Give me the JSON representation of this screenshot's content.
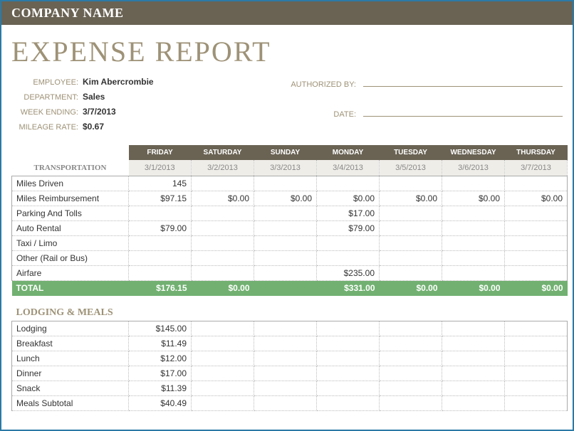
{
  "header": {
    "company": "COMPANY NAME",
    "title": "EXPENSE REPORT"
  },
  "meta": {
    "employee_label": "EMPLOYEE:",
    "employee": "Kim Abercrombie",
    "department_label": "DEPARTMENT:",
    "department": "Sales",
    "week_ending_label": "WEEK ENDING:",
    "week_ending": "3/7/2013",
    "mileage_rate_label": "MILEAGE RATE:",
    "mileage_rate": "$0.67",
    "authorized_by_label": "AUTHORIZED BY:",
    "date_label": "DATE:"
  },
  "days": [
    {
      "name": "FRIDAY",
      "date": "3/1/2013"
    },
    {
      "name": "SATURDAY",
      "date": "3/2/2013"
    },
    {
      "name": "SUNDAY",
      "date": "3/3/2013"
    },
    {
      "name": "MONDAY",
      "date": "3/4/2013"
    },
    {
      "name": "TUESDAY",
      "date": "3/5/2013"
    },
    {
      "name": "WEDNESDAY",
      "date": "3/6/2013"
    },
    {
      "name": "THURSDAY",
      "date": "3/7/2013"
    }
  ],
  "sections": {
    "transportation": {
      "label": "TRANSPORTATION",
      "total_label": "TOTAL",
      "rows": [
        {
          "label": "Miles Driven",
          "vals": [
            "145",
            "",
            "",
            "",
            "",
            "",
            ""
          ]
        },
        {
          "label": "Miles Reimbursement",
          "vals": [
            "$97.15",
            "$0.00",
            "$0.00",
            "$0.00",
            "$0.00",
            "$0.00",
            "$0.00"
          ]
        },
        {
          "label": "Parking And Tolls",
          "vals": [
            "",
            "",
            "",
            "$17.00",
            "",
            "",
            ""
          ]
        },
        {
          "label": "Auto Rental",
          "vals": [
            "$79.00",
            "",
            "",
            "$79.00",
            "",
            "",
            ""
          ]
        },
        {
          "label": "Taxi / Limo",
          "vals": [
            "",
            "",
            "",
            "",
            "",
            "",
            ""
          ]
        },
        {
          "label": "Other (Rail or Bus)",
          "vals": [
            "",
            "",
            "",
            "",
            "",
            "",
            ""
          ]
        },
        {
          "label": "Airfare",
          "vals": [
            "",
            "",
            "",
            "$235.00",
            "",
            "",
            ""
          ]
        }
      ],
      "totals": [
        "$176.15",
        "$0.00",
        "",
        "$331.00",
        "$0.00",
        "$0.00",
        "$0.00"
      ]
    },
    "lodging": {
      "label": "LODGING & MEALS",
      "rows": [
        {
          "label": "Lodging",
          "vals": [
            "$145.00",
            "",
            "",
            "",
            "",
            "",
            ""
          ]
        },
        {
          "label": "Breakfast",
          "vals": [
            "$11.49",
            "",
            "",
            "",
            "",
            "",
            ""
          ]
        },
        {
          "label": "Lunch",
          "vals": [
            "$12.00",
            "",
            "",
            "",
            "",
            "",
            ""
          ]
        },
        {
          "label": "Dinner",
          "vals": [
            "$17.00",
            "",
            "",
            "",
            "",
            "",
            ""
          ]
        },
        {
          "label": "Snack",
          "vals": [
            "$11.39",
            "",
            "",
            "",
            "",
            "",
            ""
          ]
        },
        {
          "label": "Meals Subtotal",
          "vals": [
            "$40.49",
            "",
            "",
            "",
            "",
            "",
            ""
          ]
        }
      ]
    }
  }
}
